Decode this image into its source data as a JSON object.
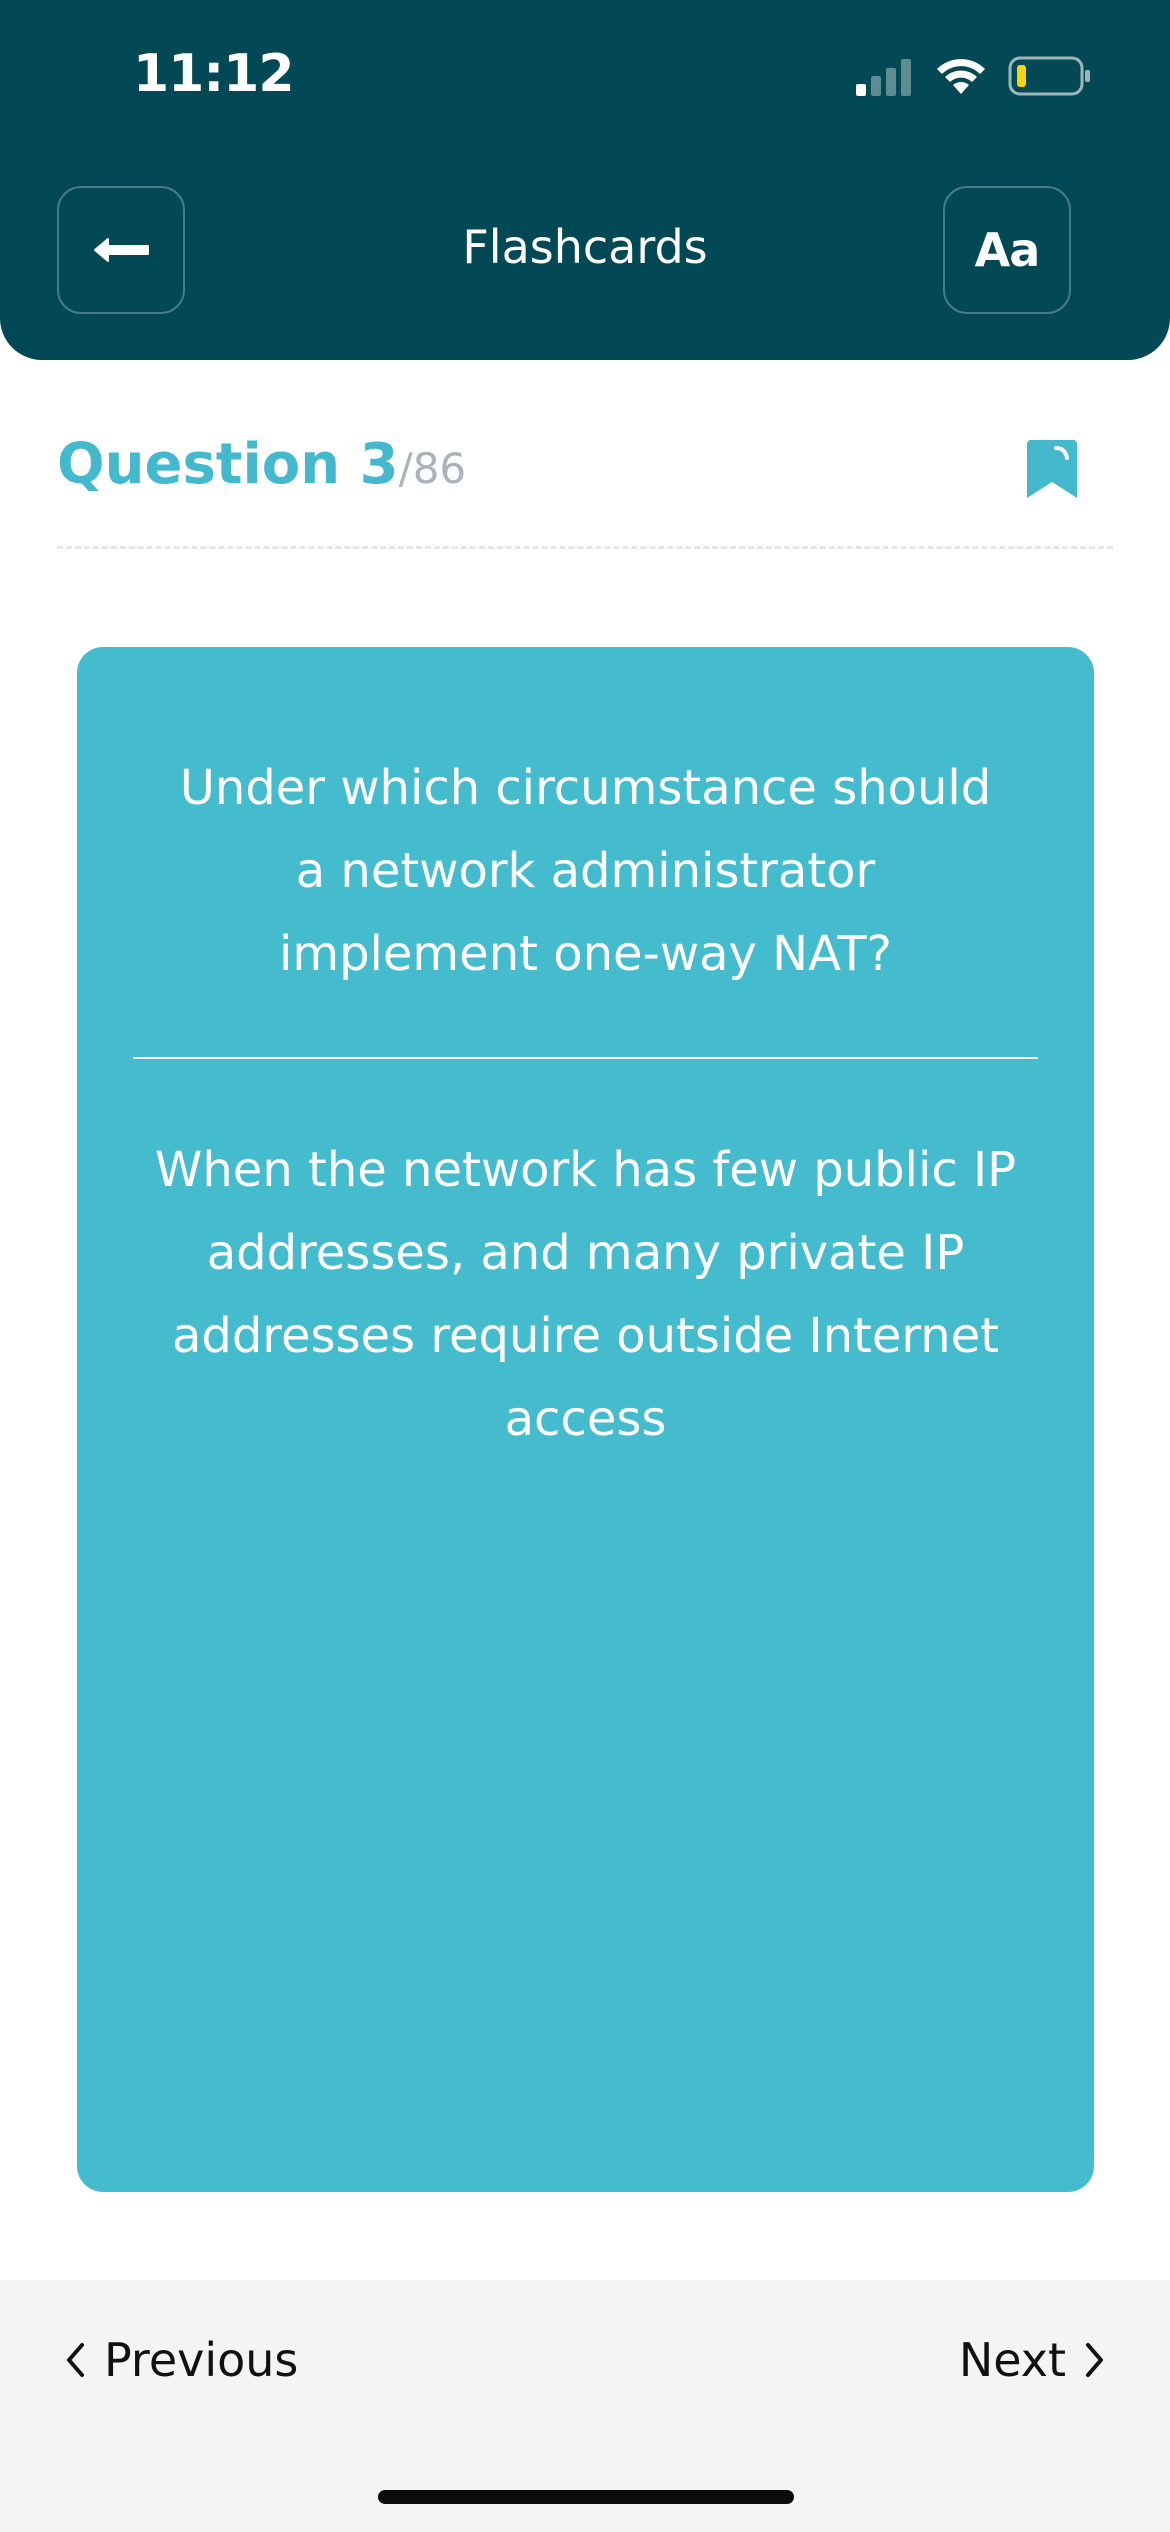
{
  "status_bar": {
    "time": "11:12"
  },
  "header": {
    "title": "Flashcards",
    "font_button_label": "Aa",
    "back_icon": "back-arrow-icon"
  },
  "question": {
    "label": "Question 3",
    "total": "/86",
    "bookmark_icon": "bookmark-icon"
  },
  "card": {
    "question": "Under which circumstance should a network administrator implement one-way NAT?",
    "answer": "When the network has few public IP addresses, and many private IP addresses require outside Internet access"
  },
  "footer": {
    "previous_label": "Previous",
    "next_label": "Next"
  },
  "colors": {
    "header_bg": "#034955",
    "accent": "#44b9cd",
    "card_bg": "#45bbce",
    "footer_bg": "#f4f4f5",
    "battery_level": "#f5d40f"
  }
}
